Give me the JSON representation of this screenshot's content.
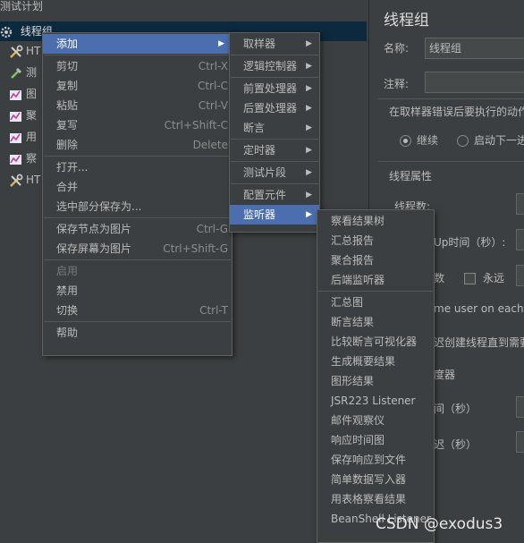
{
  "tree": {
    "plan_label": "测试计划",
    "thread_group_label": "线程组",
    "children": [
      {
        "label": "HT",
        "icon": "wrench-icon"
      },
      {
        "label": "测",
        "icon": "dropper-icon"
      },
      {
        "label": "图",
        "icon": "graph-icon"
      },
      {
        "label": "聚",
        "icon": "graph-icon"
      },
      {
        "label": "用",
        "icon": "graph-icon"
      },
      {
        "label": "察",
        "icon": "graph-icon"
      },
      {
        "label": "HT",
        "icon": "wrench-icon"
      }
    ]
  },
  "panel": {
    "title": "线程组",
    "name_label": "名称:",
    "name_value": "线程组",
    "comment_label": "注释:",
    "error_action_label": "在取样器错误后要执行的动作",
    "radio_continue": "继续",
    "radio_next": "启动下一进",
    "props_label": "线程属性",
    "threads_label": "线程数:",
    "rampup_label": "Up时间（秒）:",
    "loop_label": "数",
    "forever_label": "永远",
    "same_user_label": "me user on each it",
    "delay_create_label": "迟创建线程直到需要",
    "scheduler_label": "度器",
    "duration_label": "间（秒）",
    "startup_delay_label": "迟（秒）"
  },
  "menu_main": {
    "items": [
      {
        "label": "添加",
        "shortcut": "",
        "submenu": true,
        "selected": true,
        "disabled": false
      },
      {
        "sep": true
      },
      {
        "label": "剪切",
        "shortcut": "Ctrl-X"
      },
      {
        "label": "复制",
        "shortcut": "Ctrl-C"
      },
      {
        "label": "粘贴",
        "shortcut": "Ctrl-V"
      },
      {
        "label": "复写",
        "shortcut": "Ctrl+Shift-C"
      },
      {
        "label": "删除",
        "shortcut": "Delete"
      },
      {
        "sep": true
      },
      {
        "label": "打开...",
        "shortcut": ""
      },
      {
        "label": "合并",
        "shortcut": ""
      },
      {
        "label": "选中部分保存为...",
        "shortcut": ""
      },
      {
        "sep": true
      },
      {
        "label": "保存节点为图片",
        "shortcut": "Ctrl-G"
      },
      {
        "label": "保存屏幕为图片",
        "shortcut": "Ctrl+Shift-G"
      },
      {
        "sep": true
      },
      {
        "label": "启用",
        "shortcut": "",
        "disabled": true
      },
      {
        "label": "禁用",
        "shortcut": ""
      },
      {
        "label": "切换",
        "shortcut": "Ctrl-T"
      },
      {
        "sep": true
      },
      {
        "label": "帮助",
        "shortcut": ""
      }
    ]
  },
  "menu_add": {
    "items": [
      {
        "label": "取样器",
        "submenu": true
      },
      {
        "sep": true
      },
      {
        "label": "逻辑控制器",
        "submenu": true
      },
      {
        "sep": true
      },
      {
        "label": "前置处理器",
        "submenu": true
      },
      {
        "label": "后置处理器",
        "submenu": true
      },
      {
        "label": "断言",
        "submenu": true
      },
      {
        "sep": true
      },
      {
        "label": "定时器",
        "submenu": true
      },
      {
        "sep": true
      },
      {
        "label": "测试片段",
        "submenu": true
      },
      {
        "sep": true
      },
      {
        "label": "配置元件",
        "submenu": true
      },
      {
        "label": "监听器",
        "submenu": true,
        "selected": true
      }
    ]
  },
  "menu_listener": {
    "items": [
      {
        "label": "察看结果树"
      },
      {
        "label": "汇总报告"
      },
      {
        "label": "聚合报告"
      },
      {
        "label": "后端监听器"
      },
      {
        "sep": true
      },
      {
        "label": "汇总图"
      },
      {
        "label": "断言结果"
      },
      {
        "label": "比较断言可视化器"
      },
      {
        "label": "生成概要结果"
      },
      {
        "label": "图形结果"
      },
      {
        "label": "JSR223 Listener"
      },
      {
        "label": "邮件观察仪"
      },
      {
        "label": "响应时间图"
      },
      {
        "label": "保存响应到文件"
      },
      {
        "label": "简单数据写入器"
      },
      {
        "label": "用表格察看结果"
      },
      {
        "label": "BeanShell Listener"
      }
    ]
  },
  "watermark": "CSDN @exodus3",
  "colors": {
    "background": "#3c3f41",
    "selection": "#4b6eaf",
    "tree_selection": "#0d293e",
    "text": "#bbbbbb"
  }
}
